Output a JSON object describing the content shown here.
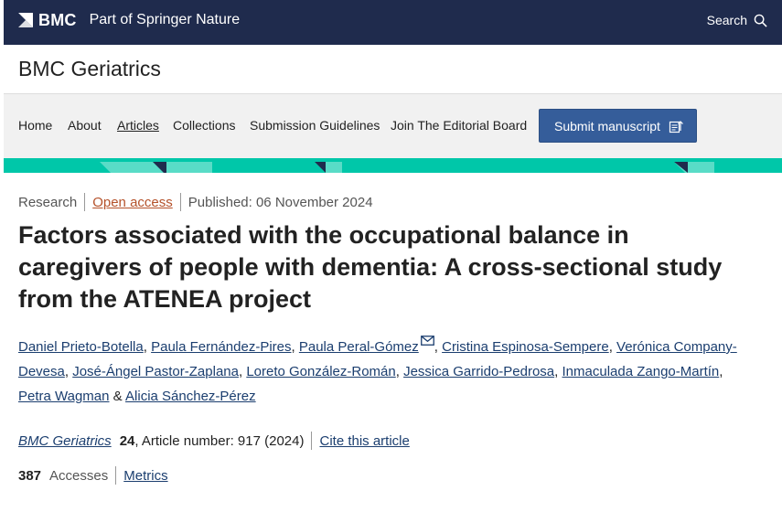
{
  "topbar": {
    "brand_name": "BMC",
    "brand_sub": "Part of Springer Nature",
    "search_label": "Search",
    "search_icon": "magnifier-icon"
  },
  "journal": {
    "title": "BMC Geriatrics"
  },
  "nav": {
    "items": [
      {
        "label": "Home"
      },
      {
        "label": "About"
      },
      {
        "label": "Articles"
      },
      {
        "label": "Collections"
      },
      {
        "label": "Submission Guidelines"
      },
      {
        "label": "Join The Editorial Board"
      }
    ],
    "active": "Articles",
    "submit_label": "Submit manuscript",
    "submit_icon": "external-link-icon"
  },
  "article": {
    "type": "Research",
    "access": "Open access",
    "published": "Published: 06 November 2024",
    "title": "Factors associated with the occupational balance in caregivers of people with dementia: A cross-sectional study from the ATENEA project",
    "authors": [
      "Daniel Prieto-Botella",
      "Paula Fernández-Pires",
      "Paula Peral-Gómez",
      "Cristina Espinosa-Sempere",
      "Verónica Company-Devesa",
      "José-Ángel Pastor-Zaplana",
      "Loreto González-Román",
      "Jessica Garrido-Pedrosa",
      "Inmaculada Zango-Martín",
      "Petra Wagman",
      "Alicia Sánchez-Pérez"
    ],
    "separators": {
      "comma": ",",
      "ampersand": "&"
    },
    "corresponding_icon": "mail-icon",
    "citation": {
      "journal": "BMC Geriatrics",
      "volume": "24",
      "article_number": ", Article number: 917 (2024)",
      "cite_label": "Cite this article"
    },
    "metrics": {
      "accesses_count": "387",
      "accesses_label": "Accesses",
      "metrics_label": "Metrics"
    }
  },
  "colors": {
    "topbar_bg": "#1f2b4d",
    "nav_bg": "#f1f1f1",
    "teal": "#00c7a9",
    "submit_bg": "#355d9a",
    "link": "#1b3e6f",
    "open_access": "#b5522b"
  }
}
